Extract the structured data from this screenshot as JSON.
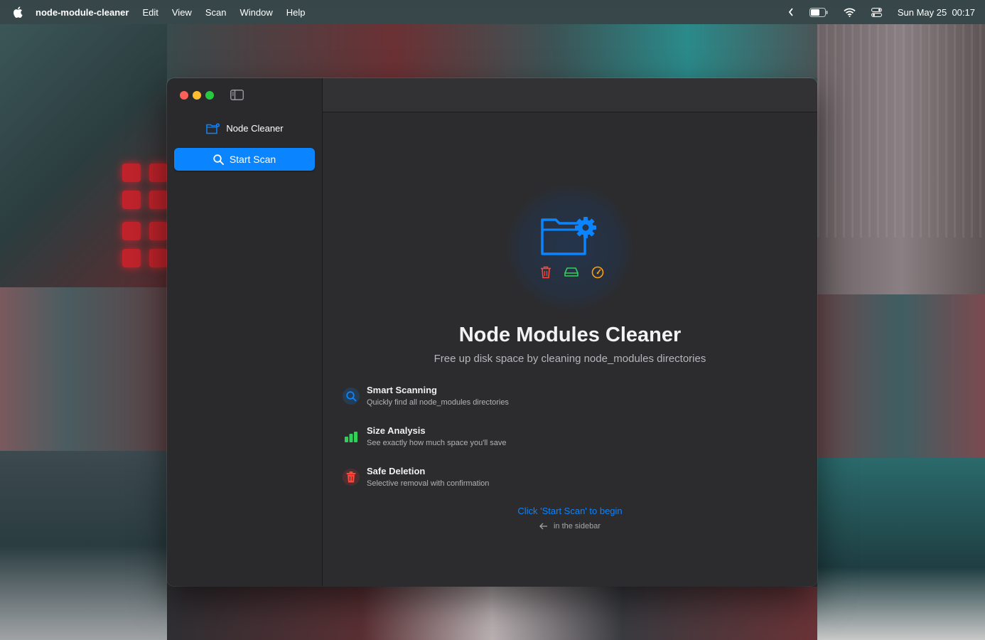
{
  "menubar": {
    "app_name": "node-module-cleaner",
    "items": [
      "Edit",
      "View",
      "Scan",
      "Window",
      "Help"
    ],
    "date": "Sun May 25",
    "time": "00:17"
  },
  "sidebar": {
    "title": "Node Cleaner",
    "scan_button_label": "Start Scan"
  },
  "main": {
    "title": "Node Modules Cleaner",
    "subtitle": "Free up disk space by cleaning node_modules directories",
    "features": [
      {
        "title": "Smart Scanning",
        "description": "Quickly find all node_modules directories",
        "icon": "magnifier-icon"
      },
      {
        "title": "Size Analysis",
        "description": "See exactly how much space you'll save",
        "icon": "bar-chart-icon"
      },
      {
        "title": "Safe Deletion",
        "description": "Selective removal with confirmation",
        "icon": "trash-icon"
      }
    ],
    "cta": "Click 'Start Scan' to begin",
    "hint": "in the sidebar"
  },
  "colors": {
    "accent": "#0a84ff",
    "danger": "#ff453a",
    "success": "#30d158",
    "warning": "#ff9f0a"
  }
}
